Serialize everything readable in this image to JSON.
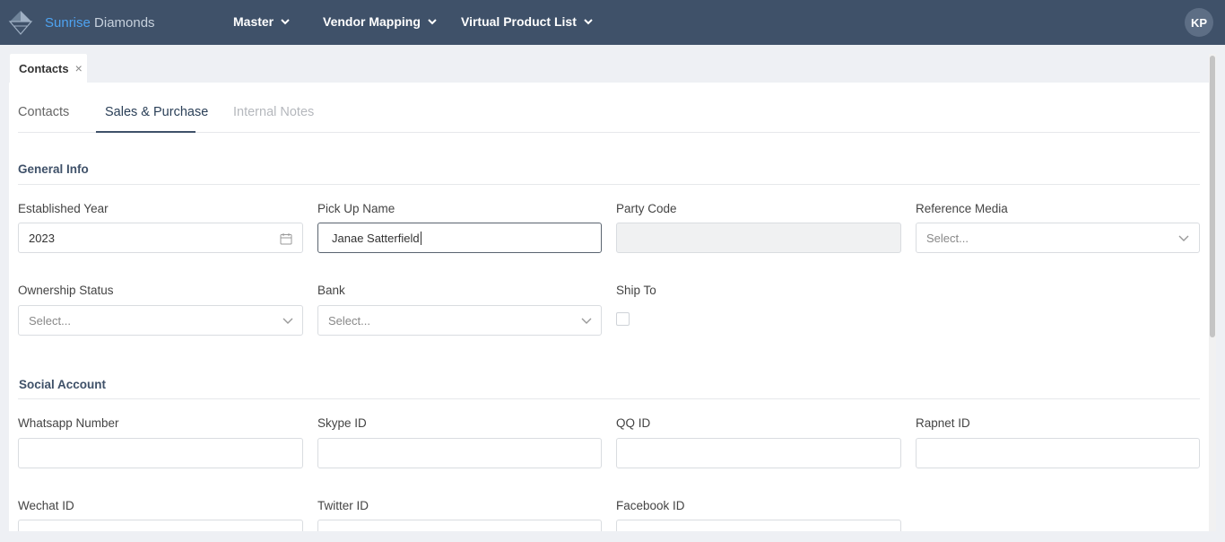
{
  "brand": {
    "name_accent": "Sunrise",
    "name_rest": "Diamonds"
  },
  "nav": {
    "items": [
      {
        "label": "Master"
      },
      {
        "label": "Vendor Mapping"
      },
      {
        "label": "Virtual Product List"
      }
    ]
  },
  "user": {
    "initials": "KP"
  },
  "doc_tab": {
    "label": "Contacts",
    "close": "×"
  },
  "subtabs": [
    {
      "label": "Contacts"
    },
    {
      "label": "Sales & Purchase"
    },
    {
      "label": "Internal Notes"
    }
  ],
  "general_info": {
    "title": "General Info",
    "established_year": {
      "label": "Established Year",
      "value": "2023"
    },
    "pick_up_name": {
      "label": "Pick Up Name",
      "value": "Janae Satterfield"
    },
    "party_code": {
      "label": "Party Code",
      "value": ""
    },
    "reference_media": {
      "label": "Reference Media",
      "placeholder": "Select..."
    },
    "ownership_status": {
      "label": "Ownership Status",
      "placeholder": "Select..."
    },
    "bank": {
      "label": "Bank",
      "placeholder": "Select..."
    },
    "ship_to": {
      "label": "Ship To",
      "checked": false
    }
  },
  "social_account": {
    "title": "Social Account",
    "whatsapp": {
      "label": "Whatsapp Number",
      "value": ""
    },
    "skype": {
      "label": "Skype ID",
      "value": ""
    },
    "qq": {
      "label": "QQ ID",
      "value": ""
    },
    "rapnet": {
      "label": "Rapnet ID",
      "value": ""
    },
    "wechat": {
      "label": "Wechat ID",
      "value": ""
    },
    "twitter": {
      "label": "Twitter ID",
      "value": ""
    },
    "facebook": {
      "label": "Facebook ID",
      "value": ""
    }
  },
  "colors": {
    "navbar": "#3f5169",
    "accent": "#4ea3f1",
    "active_tab": "#2a3f57"
  }
}
